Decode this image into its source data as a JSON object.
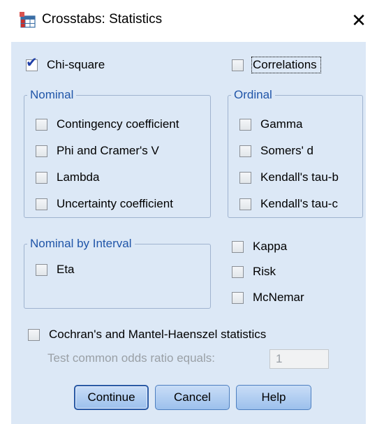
{
  "window": {
    "title": "Crosstabs: Statistics",
    "close_glyph": "✕"
  },
  "chi_square": {
    "label": "Chi-square",
    "checked": true
  },
  "correlations": {
    "label": "Correlations",
    "checked": false
  },
  "nominal": {
    "legend": "Nominal",
    "items": [
      {
        "label": "Contingency coefficient",
        "checked": false
      },
      {
        "label": "Phi and Cramer's V",
        "checked": false
      },
      {
        "label": "Lambda",
        "checked": false
      },
      {
        "label": "Uncertainty coefficient",
        "checked": false
      }
    ]
  },
  "ordinal": {
    "legend": "Ordinal",
    "items": [
      {
        "label": "Gamma",
        "checked": false
      },
      {
        "label": "Somers' d",
        "checked": false
      },
      {
        "label": "Kendall's tau-b",
        "checked": false
      },
      {
        "label": "Kendall's tau-c",
        "checked": false
      }
    ]
  },
  "nominal_by_interval": {
    "legend": "Nominal by Interval",
    "items": [
      {
        "label": "Eta",
        "checked": false
      }
    ]
  },
  "other": [
    {
      "label": "Kappa",
      "checked": false
    },
    {
      "label": "Risk",
      "checked": false
    },
    {
      "label": "McNemar",
      "checked": false
    }
  ],
  "cochran": {
    "label": "Cochran's and Mantel-Haenszel statistics",
    "checked": false
  },
  "odds_ratio": {
    "label": "Test common odds ratio equals:",
    "value": "1"
  },
  "buttons": {
    "continue": "Continue",
    "cancel": "Cancel",
    "help": "Help"
  },
  "colors": {
    "client_bg": "#dce8f6",
    "legend_text": "#2055a8",
    "button_fill": "#9cc0ec"
  },
  "icons": {
    "app": "crosstabs-table-icon",
    "check": "checkmark-icon"
  }
}
